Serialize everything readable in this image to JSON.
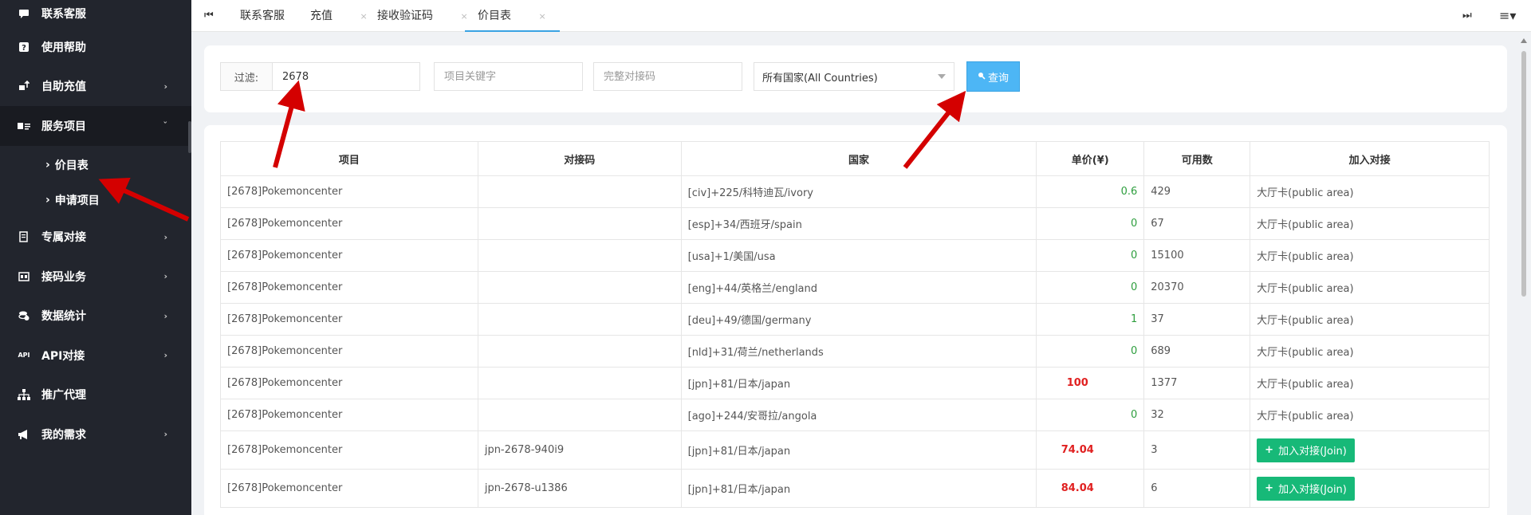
{
  "sidebar": {
    "items": [
      {
        "label": "联系客服",
        "icon": "chat-bubble-icon",
        "chevron": false
      },
      {
        "label": "使用帮助",
        "icon": "question-icon",
        "chevron": false
      },
      {
        "label": "自助充值",
        "icon": "recharge-icon",
        "chevron": true
      },
      {
        "label": "服务项目",
        "icon": "service-card-icon",
        "chevron": true,
        "expanded": true
      },
      {
        "label": "专属对接",
        "icon": "document-icon",
        "chevron": true
      },
      {
        "label": "接码业务",
        "icon": "code-icon",
        "chevron": true
      },
      {
        "label": "数据统计",
        "icon": "coins-icon",
        "chevron": true
      },
      {
        "label": "API对接",
        "icon": "api-icon",
        "chevron": true
      },
      {
        "label": "推广代理",
        "icon": "network-icon",
        "chevron": false
      },
      {
        "label": "我的需求",
        "icon": "megaphone-icon",
        "chevron": true
      }
    ],
    "sub_items": [
      {
        "label": "价目表",
        "active": true
      },
      {
        "label": "申请项目",
        "active": false
      }
    ]
  },
  "tabs": {
    "items": [
      {
        "label": "联系客服",
        "closable": false
      },
      {
        "label": "充值",
        "closable": true
      },
      {
        "label": "接收验证码",
        "closable": true
      },
      {
        "label": "价目表",
        "closable": true,
        "active": true
      }
    ],
    "close_glyph": "×"
  },
  "filter": {
    "label": "过滤:",
    "value": "2678",
    "keyword_placeholder": "项目关键字",
    "code_placeholder": "完整对接码",
    "country_selected": "所有国家(All Countries)",
    "query_label": "查询"
  },
  "table": {
    "headers": [
      "项目",
      "对接码",
      "国家",
      "单价(¥)",
      "可用数",
      "加入对接"
    ],
    "rows": [
      {
        "project": "[2678]Pokemoncenter",
        "code": "",
        "country": "[civ]+225/科特迪瓦/ivory",
        "price": "0.6",
        "price_color": "green",
        "available": "429",
        "join": "大厅卡(public area)"
      },
      {
        "project": "[2678]Pokemoncenter",
        "code": "",
        "country": "[esp]+34/西班牙/spain",
        "price": "0",
        "price_color": "green",
        "available": "67",
        "join": "大厅卡(public area)"
      },
      {
        "project": "[2678]Pokemoncenter",
        "code": "",
        "country": "[usa]+1/美国/usa",
        "price": "0",
        "price_color": "green",
        "available": "15100",
        "join": "大厅卡(public area)"
      },
      {
        "project": "[2678]Pokemoncenter",
        "code": "",
        "country": "[eng]+44/英格兰/england",
        "price": "0",
        "price_color": "green",
        "available": "20370",
        "join": "大厅卡(public area)"
      },
      {
        "project": "[2678]Pokemoncenter",
        "code": "",
        "country": "[deu]+49/德国/germany",
        "price": "1",
        "price_color": "green",
        "available": "37",
        "join": "大厅卡(public area)"
      },
      {
        "project": "[2678]Pokemoncenter",
        "code": "",
        "country": "[nld]+31/荷兰/netherlands",
        "price": "0",
        "price_color": "green",
        "available": "689",
        "join": "大厅卡(public area)"
      },
      {
        "project": "[2678]Pokemoncenter",
        "code": "",
        "country": "[jpn]+81/日本/japan",
        "price": "100",
        "price_color": "red",
        "available": "1377",
        "join": "大厅卡(public area)"
      },
      {
        "project": "[2678]Pokemoncenter",
        "code": "",
        "country": "[ago]+244/安哥拉/angola",
        "price": "0",
        "price_color": "green",
        "available": "32",
        "join": "大厅卡(public area)"
      },
      {
        "project": "[2678]Pokemoncenter",
        "code": "jpn-2678-940i9",
        "country": "[jpn]+81/日本/japan",
        "price": "74.04",
        "price_color": "red",
        "available": "3",
        "join_button": "加入对接(Join)"
      },
      {
        "project": "[2678]Pokemoncenter",
        "code": "jpn-2678-u1386",
        "country": "[jpn]+81/日本/japan",
        "price": "84.04",
        "price_color": "red",
        "available": "6",
        "join_button": "加入对接(Join)"
      }
    ]
  },
  "colors": {
    "sidebar_bg": "#22252d",
    "accent": "#3aa3e3",
    "query_button": "#4db6f5",
    "join_button": "#17b978",
    "price_green": "#2e9e3e",
    "price_red": "#e02020",
    "annotation_arrow": "#d40000"
  }
}
